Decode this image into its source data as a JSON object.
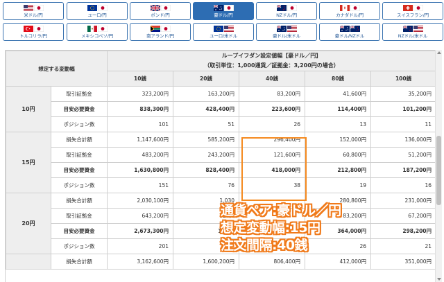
{
  "tabs_row1": [
    {
      "label": "米ドル/円",
      "flags": [
        "us",
        "jp"
      ],
      "active": false
    },
    {
      "label": "ユーロ/円",
      "flags": [
        "eu",
        "jp"
      ],
      "active": false
    },
    {
      "label": "ポンド/円",
      "flags": [
        "gb",
        "jp"
      ],
      "active": false
    },
    {
      "label": "豪ドル/円",
      "flags": [
        "au",
        "jp"
      ],
      "active": true
    },
    {
      "label": "NZドル/円",
      "flags": [
        "nz",
        "jp"
      ],
      "active": false
    },
    {
      "label": "カナダドル/円",
      "flags": [
        "ca",
        "jp"
      ],
      "active": false
    },
    {
      "label": "スイスフラン/円",
      "flags": [
        "ch",
        "jp"
      ],
      "active": false
    }
  ],
  "tabs_row2": [
    {
      "label": "トルコリラ/円",
      "flags": [
        "tr",
        "jp"
      ],
      "active": false
    },
    {
      "label": "メキシコペソ/円",
      "flags": [
        "mx",
        "jp"
      ],
      "active": false
    },
    {
      "label": "南アランド/円",
      "flags": [
        "za",
        "jp"
      ],
      "active": false
    },
    {
      "label": "ユーロ/米ドル",
      "flags": [
        "eu",
        "us"
      ],
      "active": false
    },
    {
      "label": "豪ドル/米ドル",
      "flags": [
        "au",
        "us"
      ],
      "active": false
    },
    {
      "label": "豪ドル/NZドル",
      "flags": [
        "au",
        "nz"
      ],
      "active": false
    },
    {
      "label": "NZドル/米ドル",
      "flags": [
        "nz",
        "us"
      ],
      "active": false
    }
  ],
  "table": {
    "corner_label": "想定する変動幅",
    "title_line1": "ループイフダン設定値幅【豪ドル／円】",
    "title_line2": "（取引単位：1,000通貨／証拠金：3,200円の場合）",
    "columns": [
      "10銭",
      "20銭",
      "40銭",
      "80銭",
      "100銭"
    ],
    "groups": [
      {
        "range": "10円",
        "rows": [
          {
            "label": "取引証拠金",
            "bold": false,
            "values": [
              "323,200円",
              "163,200円",
              "83,200円",
              "41,600円",
              "35,200円"
            ]
          },
          {
            "label": "目安必要資金",
            "bold": true,
            "values": [
              "838,300円",
              "428,400円",
              "223,600円",
              "114,400円",
              "101,200円"
            ]
          },
          {
            "label": "ポジション数",
            "bold": false,
            "values": [
              "101",
              "51",
              "26",
              "13",
              "11"
            ]
          }
        ]
      },
      {
        "range": "15円",
        "rows": [
          {
            "label": "損失合計額",
            "bold": false,
            "values": [
              "1,147,600円",
              "585,200円",
              "296,400円",
              "152,000円",
              "136,000円"
            ]
          },
          {
            "label": "取引証拠金",
            "bold": false,
            "values": [
              "483,200円",
              "243,200円",
              "121,600円",
              "60,800円",
              "51,200円"
            ]
          },
          {
            "label": "目安必要資金",
            "bold": true,
            "values": [
              "1,630,800円",
              "828,400円",
              "418,000円",
              "212,800円",
              "187,200円"
            ]
          },
          {
            "label": "ポジション数",
            "bold": false,
            "values": [
              "151",
              "76",
              "38",
              "19",
              "16"
            ]
          }
        ]
      },
      {
        "range": "20円",
        "rows": [
          {
            "label": "損失合計額",
            "bold": false,
            "values": [
              "2,030,100円",
              "1,030",
              "",
              "280,800円",
              "231,000円"
            ]
          },
          {
            "label": "取引証拠金",
            "bold": false,
            "values": [
              "643,200円",
              "323,2",
              "",
              "83,200円",
              "67,200円"
            ]
          },
          {
            "label": "目安必要資金",
            "bold": true,
            "values": [
              "2,673,300円",
              "1,353",
              "",
              "364,000円",
              "298,200円"
            ]
          },
          {
            "label": "ポジション数",
            "bold": false,
            "values": [
              "201",
              "",
              "",
              "26",
              "21"
            ]
          }
        ]
      },
      {
        "range": "",
        "rows": [
          {
            "label": "損失合計額",
            "bold": false,
            "values": [
              "3,162,600円",
              "1,600,200円",
              "806,400円",
              "412,000円",
              "351,000円"
            ]
          }
        ]
      }
    ]
  },
  "overlay": {
    "line1": "通貨ペア:豪ドル／円",
    "line2": "想定変動幅:15円",
    "line3": "注文間隔:40銭"
  },
  "colors": {
    "accent_blue": "#2d6db3",
    "highlight_orange": "#f58a1f"
  }
}
